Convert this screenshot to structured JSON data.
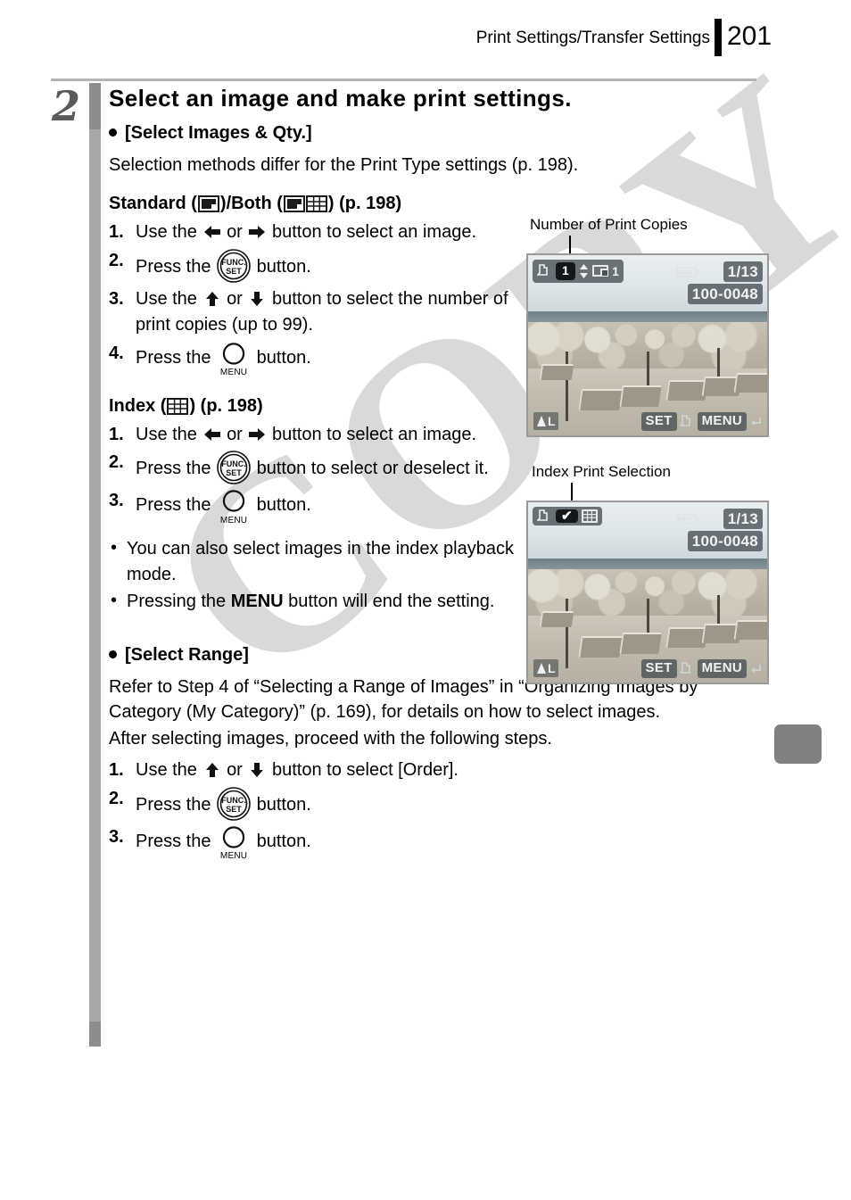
{
  "header": {
    "title": "Print Settings/Transfer Settings",
    "page_number": "201"
  },
  "watermark": {
    "text": "COPY"
  },
  "step": {
    "number": "2",
    "heading": "Select an image and make print settings."
  },
  "section_select_images": {
    "bullet_label": "[Select Images & Qty.]",
    "intro": "Selection methods differ for the Print Type settings (p. 198).",
    "standard": {
      "label_prefix": "Standard (",
      "label_middle": ")/Both (",
      "label_suffix": ") (p. 198)",
      "icon_standard": "standard-print-icon",
      "icon_both_standard": "standard-print-icon",
      "icon_both_index": "index-print-icon",
      "steps": [
        {
          "num": "1.",
          "text_a": "Use the",
          "icon_a": "arrow-left-icon",
          "text_b": "or",
          "icon_b": "arrow-right-icon",
          "text_c": "button to select an image."
        },
        {
          "num": "2.",
          "text_a": "Press the",
          "icon_a": "func-set-button-icon",
          "text_c": "button."
        },
        {
          "num": "3.",
          "text_a": "Use the",
          "icon_a": "arrow-up-icon",
          "text_b": "or",
          "icon_b": "arrow-down-icon",
          "text_c": "button to select the number of print copies (up to 99)."
        },
        {
          "num": "4.",
          "text_a": "Press the",
          "icon_a": "menu-button-icon",
          "text_c": "button."
        }
      ]
    },
    "index": {
      "label_prefix": "Index (",
      "label_suffix": ") (p. 198)",
      "icon_index": "index-print-icon",
      "steps": [
        {
          "num": "1.",
          "text_a": "Use the",
          "icon_a": "arrow-left-icon",
          "text_b": "or",
          "icon_b": "arrow-right-icon",
          "text_c": "button to select an image."
        },
        {
          "num": "2.",
          "text_a": "Press the",
          "icon_a": "func-set-button-icon",
          "text_c": "button to select or deselect it."
        },
        {
          "num": "3.",
          "text_a": "Press the",
          "icon_a": "menu-button-icon",
          "text_c": "button."
        }
      ]
    },
    "notes": [
      {
        "marker": "•",
        "text": "You can also select images in the index playback mode."
      },
      {
        "marker": "•",
        "text_before": "Pressing the ",
        "bold": "MENU",
        "text_after": " button will end the setting."
      }
    ]
  },
  "section_select_range": {
    "bullet_label": "[Select Range]",
    "para1": "Refer to Step 4 of “Selecting a Range of Images” in “Organizing Images by Category (My Category)” (p. 169), for details on how to select images.",
    "para2": "After selecting images, proceed with the following steps.",
    "steps": [
      {
        "num": "1.",
        "text_a": "Use the",
        "icon_a": "arrow-up-icon",
        "text_b": "or",
        "icon_b": "arrow-down-icon",
        "text_c": "button to select [Order]."
      },
      {
        "num": "2.",
        "text_a": "Press the",
        "icon_a": "func-set-button-icon",
        "text_c": "button."
      },
      {
        "num": "3.",
        "text_a": "Press the",
        "icon_a": "menu-button-icon",
        "text_c": "button."
      }
    ]
  },
  "callouts": {
    "copies": "Number of Print Copies",
    "index": "Index Print Selection"
  },
  "lcd_standard": {
    "print_icon": "print-order-icon",
    "copies_value": "1",
    "stepper_icon": "up-down-arrows-icon",
    "type_icon": "standard-print-icon",
    "type_value": "1",
    "battery_icon": "battery-full-icon",
    "frame_counter": "1/13",
    "file_number": "100-0048",
    "quality_icon": "image-quality-large-icon",
    "quality_label": "L",
    "set_label": "SET",
    "set_action_icon": "print-order-icon",
    "menu_label": "MENU",
    "menu_action_icon": "return-arrow-icon"
  },
  "lcd_index": {
    "print_icon": "print-order-icon",
    "check_mark": "✔",
    "type_icon": "index-print-icon",
    "battery_icon": "battery-full-icon",
    "frame_counter": "1/13",
    "file_number": "100-0048",
    "quality_icon": "image-quality-large-icon",
    "quality_label": "L",
    "set_label": "SET",
    "set_action_icon": "print-order-icon",
    "menu_label": "MENU",
    "menu_action_icon": "return-arrow-icon"
  },
  "colors": {
    "rule": "#b4b4b4",
    "sidebar_dark": "#8c8c8c",
    "sidebar_light": "#a8a8a8",
    "step_number": "#5a5a5a",
    "tab": "#808080",
    "watermark": "#d9d9d9"
  }
}
